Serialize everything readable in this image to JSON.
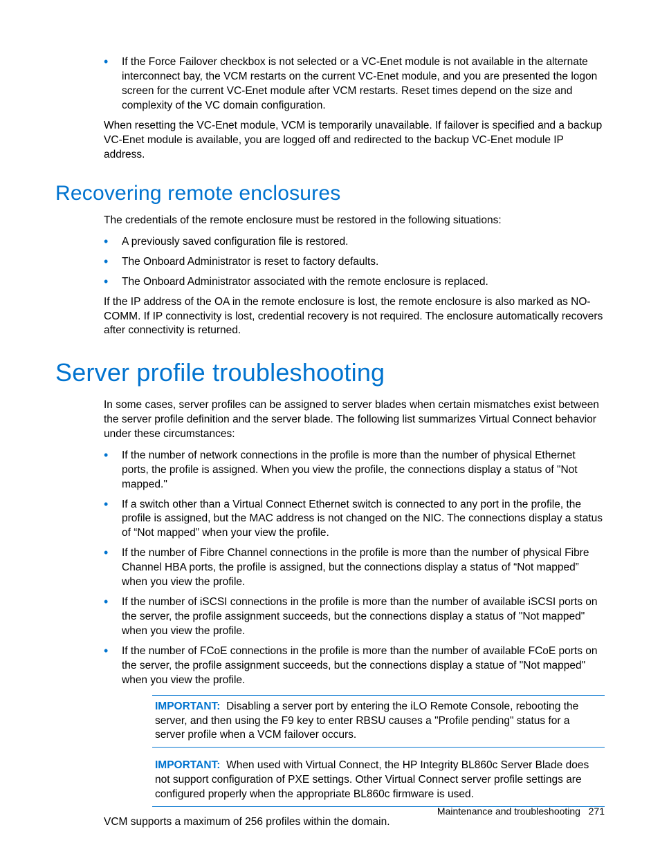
{
  "top_bullet": "If the Force Failover checkbox is not selected or a VC-Enet module is not available in the alternate interconnect bay, the VCM restarts on the current VC-Enet module, and you are presented the logon screen for the current VC-Enet module after VCM restarts. Reset times depend on the size and complexity of the VC domain configuration.",
  "top_para": "When resetting the VC-Enet module, VCM is temporarily unavailable. If failover is specified and a backup VC-Enet module is available, you are logged off and redirected to the backup VC-Enet module IP address.",
  "recovering": {
    "heading": "Recovering remote enclosures",
    "intro": "The credentials of the remote enclosure must be restored in the following situations:",
    "bullets": [
      "A previously saved configuration file is restored.",
      "The Onboard Administrator is reset to factory defaults.",
      "The Onboard Administrator associated with the remote enclosure is replaced."
    ],
    "after": "If the IP address of the OA in the remote enclosure is lost, the remote enclosure is also marked as NO-COMM. If IP connectivity is lost, credential recovery is not required. The enclosure automatically recovers after connectivity is returned."
  },
  "troubleshooting": {
    "heading": "Server profile troubleshooting",
    "intro": "In some cases, server profiles can be assigned to server blades when certain mismatches exist between the server profile definition and the server blade. The following list summarizes Virtual Connect behavior under these circumstances:",
    "bullets": [
      "If the number of network connections in the profile is more than the number of physical Ethernet ports, the profile is assigned. When you view the profile, the connections display a status of \"Not mapped.\"",
      "If a switch other than a Virtual Connect Ethernet switch is connected to any port in the profile, the profile is assigned, but the MAC address is not changed on the NIC. The connections display a status of “Not mapped” when your view the profile.",
      "If the number of Fibre Channel connections in the profile is more than the number of physical Fibre Channel HBA ports, the profile is assigned, but the connections display a status of “Not mapped” when you view the profile.",
      "If the number of iSCSI connections in the profile is more than the number of available iSCSI ports on the server, the profile assignment succeeds, but the connections display a status of \"Not mapped\" when you view the profile.",
      "If the number of FCoE connections in the profile is more than the number of available FCoE ports on the server, the profile assignment succeeds, but the connections display a statue of \"Not mapped\" when you view the profile."
    ],
    "important_label": "IMPORTANT:",
    "important1": "Disabling a server port by entering the iLO Remote Console, rebooting the server, and then using the F9 key to enter RBSU causes a \"Profile pending\" status for a server profile when a VCM failover occurs.",
    "important2": "When used with Virtual Connect, the HP Integrity BL860c Server Blade does not support configuration of PXE settings. Other Virtual Connect server profile settings are configured properly when the appropriate BL860c firmware is used.",
    "final": "VCM supports a maximum of 256 profiles within the domain."
  },
  "footer": {
    "section": "Maintenance and troubleshooting",
    "page": "271"
  }
}
